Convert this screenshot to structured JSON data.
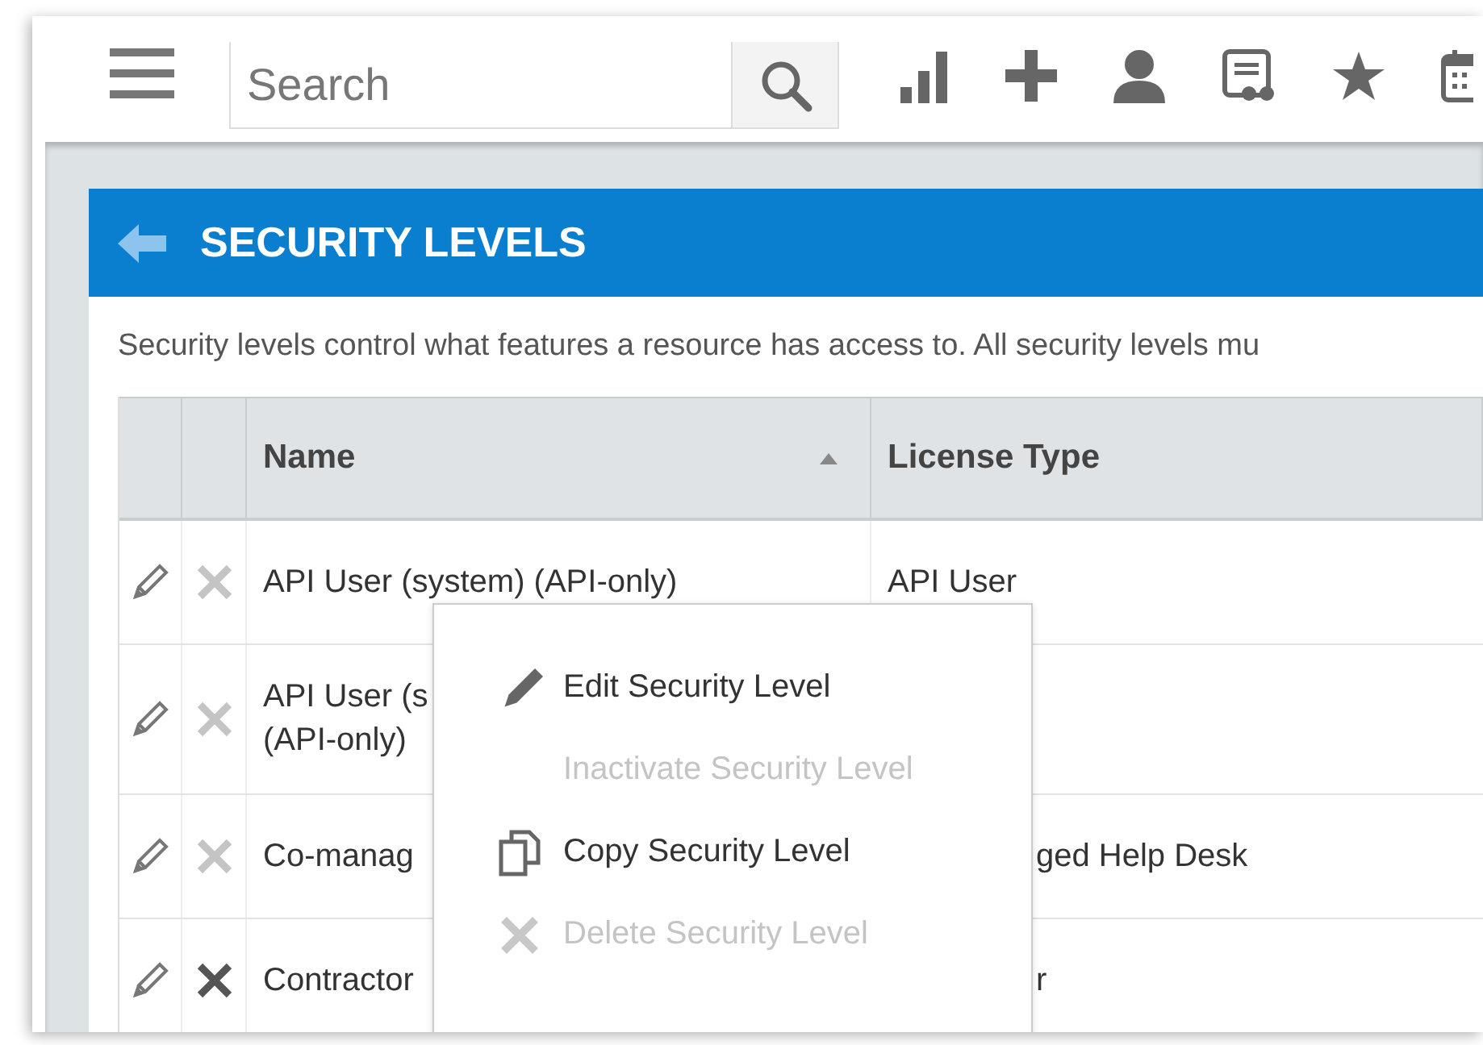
{
  "search": {
    "placeholder": "Search"
  },
  "page": {
    "title": "SECURITY LEVELS",
    "description": "Security levels control what features a resource has access to. All security levels mu"
  },
  "table": {
    "columns": [
      {
        "label": "Name",
        "sorted": true
      },
      {
        "label": "License Type",
        "sorted": false
      }
    ],
    "rows": [
      {
        "name": [
          "API User (system) (API-only)"
        ],
        "license": "API User",
        "delete_disabled": true
      },
      {
        "name": [
          "API User (s",
          "(API-only)"
        ],
        "license": "",
        "delete_disabled": true
      },
      {
        "name": [
          "Co-manag"
        ],
        "license": "ged Help Desk",
        "delete_disabled": true
      },
      {
        "name": [
          "Contractor"
        ],
        "license": "r",
        "delete_disabled": false
      }
    ]
  },
  "context_menu": {
    "items": [
      {
        "label": "Edit Security Level",
        "kind": "edit",
        "disabled": false
      },
      {
        "label": "Inactivate Security Level",
        "kind": "plain",
        "disabled": true
      },
      {
        "label": "Copy Security Level",
        "kind": "copy",
        "disabled": false
      },
      {
        "label": "Delete Security Level",
        "kind": "delete",
        "disabled": true
      }
    ]
  }
}
